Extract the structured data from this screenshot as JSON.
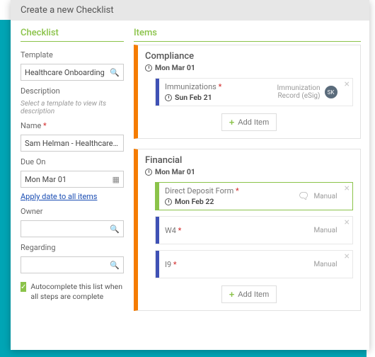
{
  "header": {
    "title": "Create a new Checklist"
  },
  "left": {
    "sectionTitle": "Checklist",
    "templateLabel": "Template",
    "templateValue": "Healthcare Onboarding",
    "descriptionLabel": "Description",
    "descriptionHelp": "Select a template to view its description",
    "nameLabel": "Name",
    "nameValue": "Sam Helman - Healthcare Onbo...",
    "dueLabel": "Due On",
    "dueValue": "Mon Mar 01",
    "applyLink": "Apply date to all items",
    "ownerLabel": "Owner",
    "ownerValue": "",
    "regardingLabel": "Regarding",
    "regardingValue": "",
    "autoLabel": "Autocomplete this list when all steps are complete"
  },
  "right": {
    "sectionTitle": "Items",
    "addItem": "Add Item",
    "groups": [
      {
        "title": "Compliance",
        "date": "Mon Mar 01",
        "items": [
          {
            "name": "Immunizations",
            "date": "Sun Feb 21",
            "metaLine1": "Immunization",
            "metaLine2": "Record (eSig)",
            "avatar": "SK",
            "active": false,
            "hasChat": false
          }
        ]
      },
      {
        "title": "Financial",
        "date": "Mon Mar 01",
        "items": [
          {
            "name": "Direct Deposit Form",
            "date": "Mon Feb 22",
            "metaLine1": "Manual",
            "metaLine2": "",
            "avatar": "",
            "active": true,
            "hasChat": true
          },
          {
            "name": "W4",
            "date": "",
            "metaLine1": "Manual",
            "metaLine2": "",
            "avatar": "",
            "active": false,
            "hasChat": false
          },
          {
            "name": "I9",
            "date": "",
            "metaLine1": "Manual",
            "metaLine2": "",
            "avatar": "",
            "active": false,
            "hasChat": false
          }
        ]
      }
    ]
  }
}
